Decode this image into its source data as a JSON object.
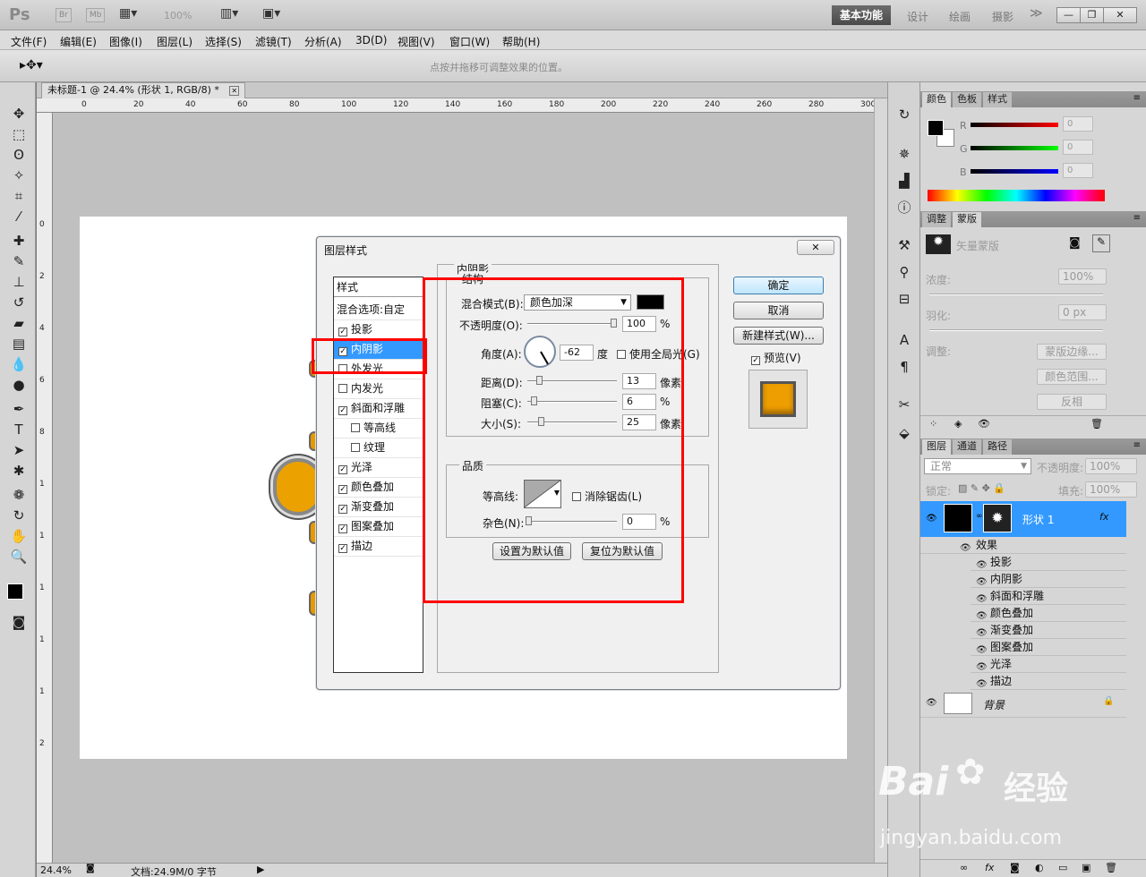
{
  "app": {
    "logo": "Ps",
    "bridge": "Br",
    "minibridge": "Mb",
    "zoom": "100%",
    "workspaces": {
      "active": "基本功能",
      "design": "设计",
      "paint": "绘画",
      "photo": "摄影",
      "more": "≫"
    },
    "window_controls": {
      "minimize": "—",
      "restore": "❐",
      "close": "✕"
    }
  },
  "menu": [
    "文件(F)",
    "编辑(E)",
    "图像(I)",
    "图层(L)",
    "选择(S)",
    "滤镜(T)",
    "分析(A)",
    "3D(D)",
    "视图(V)",
    "窗口(W)",
    "帮助(H)"
  ],
  "options_bar": {
    "tool_icon": "move-tool-icon",
    "hint": "点按并拖移可调整效果的位置。"
  },
  "document": {
    "tab_title": "未标题-1 @ 24.4% (形状 1, RGB/8) *",
    "ruler_h": [
      "0",
      "20",
      "40",
      "60",
      "80",
      "100",
      "120",
      "140",
      "160",
      "180",
      "200",
      "220",
      "240",
      "260",
      "280",
      "300"
    ],
    "ruler_v": [
      "0",
      "2",
      "4",
      "6",
      "8",
      "1",
      "1",
      "1",
      "1",
      "1",
      "2"
    ],
    "zoom": "24.4%",
    "doc_info": "文档:24.9M/0 字节"
  },
  "dialog": {
    "title": "图层样式",
    "close": "✕",
    "style_header": "样式",
    "blend_options": "混合选项:自定",
    "styles": [
      {
        "label": "投影",
        "checked": true,
        "selected": false,
        "indent": false
      },
      {
        "label": "内阴影",
        "checked": true,
        "selected": true,
        "indent": false
      },
      {
        "label": "外发光",
        "checked": false,
        "selected": false,
        "indent": false
      },
      {
        "label": "内发光",
        "checked": false,
        "selected": false,
        "indent": false
      },
      {
        "label": "斜面和浮雕",
        "checked": true,
        "selected": false,
        "indent": false
      },
      {
        "label": "等高线",
        "checked": false,
        "selected": false,
        "indent": true
      },
      {
        "label": "纹理",
        "checked": false,
        "selected": false,
        "indent": true
      },
      {
        "label": "光泽",
        "checked": true,
        "selected": false,
        "indent": false
      },
      {
        "label": "颜色叠加",
        "checked": true,
        "selected": false,
        "indent": false
      },
      {
        "label": "渐变叠加",
        "checked": true,
        "selected": false,
        "indent": false
      },
      {
        "label": "图案叠加",
        "checked": true,
        "selected": false,
        "indent": false
      },
      {
        "label": "描边",
        "checked": true,
        "selected": false,
        "indent": false
      }
    ],
    "section_title": "内阴影",
    "structure": {
      "label": "结构",
      "blend_mode_label": "混合模式(B):",
      "blend_mode": "颜色加深",
      "shadow_color": "#000000",
      "opacity_label": "不透明度(O):",
      "opacity": "100",
      "percent": "%",
      "angle_label": "角度(A):",
      "angle": "-62",
      "angle_unit": "度",
      "global_light": "使用全局光(G)",
      "distance_label": "距离(D):",
      "distance": "13",
      "choke_label": "阻塞(C):",
      "choke": "6",
      "size_label": "大小(S):",
      "size": "25",
      "px_unit": "像素"
    },
    "quality": {
      "label": "品质",
      "contour_label": "等高线:",
      "anti_alias": "消除锯齿(L)",
      "noise_label": "杂色(N):",
      "noise": "0"
    },
    "buttons": {
      "set_default": "设置为默认值",
      "reset_default": "复位为默认值",
      "ok": "确定",
      "cancel": "取消",
      "new_style": "新建样式(W)...",
      "preview": "预览(V)"
    }
  },
  "color_panel": {
    "tabs": [
      "颜色",
      "色板",
      "样式"
    ],
    "r": "0",
    "g": "0",
    "b": "0",
    "r_label": "R",
    "g_label": "G",
    "b_label": "B"
  },
  "masks_panel": {
    "tabs": [
      "调整",
      "蒙版"
    ],
    "title": "矢量蒙版",
    "density_label": "浓度:",
    "density": "100%",
    "feather_label": "羽化:",
    "feather": "0 px",
    "refine_label": "调整:",
    "mask_edge": "蒙版边缘...",
    "color_range": "颜色范围...",
    "invert": "反相"
  },
  "layers_panel": {
    "tabs": [
      "图层",
      "通道",
      "路径"
    ],
    "blend_mode": "正常",
    "opacity_label": "不透明度:",
    "opacity": "100%",
    "lock_label": "锁定:",
    "fill_label": "填充:",
    "fill": "100%",
    "shape_layer": "形状 1",
    "fx": "fx",
    "effects_label": "效果",
    "effects": [
      "投影",
      "内阴影",
      "斜面和浮雕",
      "颜色叠加",
      "渐变叠加",
      "图案叠加",
      "光泽",
      "描边"
    ],
    "background_layer": "背景"
  },
  "watermark": {
    "brand": "Bai",
    "brand_cn": "经验",
    "url": "jingyan.baidu.com"
  }
}
